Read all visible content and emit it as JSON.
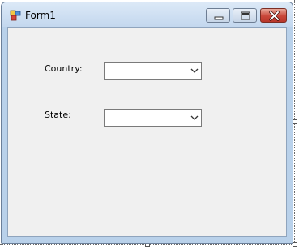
{
  "window": {
    "title": "Form1",
    "icons": {
      "app": "form-app-icon",
      "minimize": "minimize-icon",
      "maximize": "maximize-icon",
      "close": "close-icon"
    },
    "colors": {
      "titlebar": "#dce9f7",
      "frame": "#b9d1ea",
      "client": "#f0f0f0",
      "close_button": "#c9473a"
    }
  },
  "form": {
    "country": {
      "label": "Country:",
      "value": ""
    },
    "state": {
      "label": "State:",
      "value": ""
    }
  }
}
